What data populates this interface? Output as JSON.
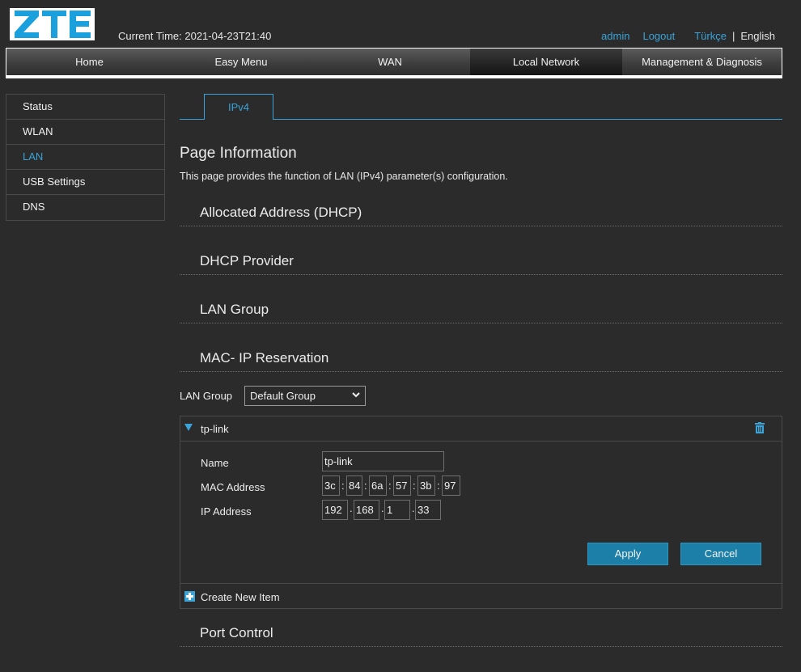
{
  "header": {
    "logo_text": "ZTE",
    "current_time": "Current Time: 2021-04-23T21:40",
    "user": "admin",
    "logout": "Logout",
    "lang_tr": "Türkçe",
    "lang_sep": "|",
    "lang_en": "English"
  },
  "nav": {
    "items": [
      "Home",
      "Easy Menu",
      "WAN",
      "Local Network",
      "Management & Diagnosis"
    ],
    "active": "Local Network"
  },
  "sidebar": {
    "items": [
      "Status",
      "WLAN",
      "LAN",
      "USB Settings",
      "DNS"
    ],
    "active": "LAN"
  },
  "tabs": [
    "IPv4"
  ],
  "page": {
    "title": "Page Information",
    "description": "This page provides the function of LAN (IPv4) parameter(s) configuration."
  },
  "sections": [
    "Allocated Address (DHCP)",
    "DHCP Provider",
    "LAN Group",
    "MAC- IP Reservation",
    "Port Control"
  ],
  "reservation": {
    "lan_group_label": "LAN Group",
    "lan_group_value": "Default Group",
    "item_name": "tp-link",
    "fields": {
      "name_label": "Name",
      "name_value": "tp-link",
      "mac_label": "MAC Address",
      "mac": [
        "3c",
        "84",
        "6a",
        "57",
        "3b",
        "97"
      ],
      "ip_label": "IP Address",
      "ip": [
        "192",
        "168",
        "1",
        "33"
      ]
    },
    "apply": "Apply",
    "cancel": "Cancel",
    "create_new": "Create New Item"
  },
  "colors": {
    "accent": "#3aa3d8",
    "background": "#2b2b2b",
    "button": "#1b7fa8",
    "logo": "#1aa0dc"
  },
  "icons": [
    "triangle-down-icon",
    "trash-icon",
    "plus-box-icon",
    "chevron-down-icon"
  ]
}
